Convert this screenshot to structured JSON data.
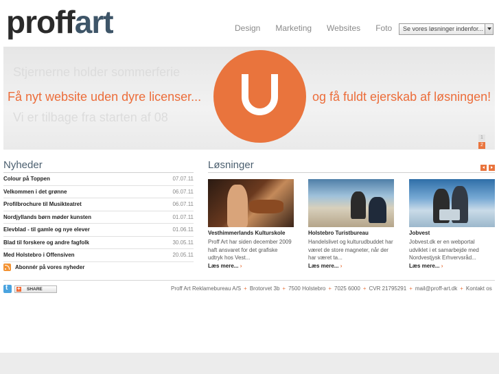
{
  "header": {
    "logo_part1": "proff",
    "logo_part2": "art",
    "nav": [
      "Design",
      "Marketing",
      "Websites",
      "Foto"
    ],
    "search_select_value": "Se vores løsninger indenfor..."
  },
  "banner": {
    "ghost_text_1": "Stjernerne holder sommerferie",
    "ghost_text_2": "Vi er tilbage fra starten af 08",
    "left_text": "Få nyt website uden dyre licenser...",
    "right_text": "og få fuldt ejerskab af løsningen!",
    "slides": [
      "1",
      "2"
    ],
    "accent_color": "#e9743d"
  },
  "news": {
    "title": "Nyheder",
    "items": [
      {
        "headline": "Colour på Toppen",
        "date": "07.07.11"
      },
      {
        "headline": "Velkommen i det grønne",
        "date": "06.07.11"
      },
      {
        "headline": "Profilbrochure til Musikteatret",
        "date": "06.07.11"
      },
      {
        "headline": "Nordjyllands børn møder kunsten",
        "date": "01.07.11"
      },
      {
        "headline": "Elevblad - til gamle og nye elever",
        "date": "01.06.11"
      },
      {
        "headline": "Blad til forskere og andre fagfolk",
        "date": "30.05.11"
      },
      {
        "headline": "Med Holstebro i Offensiven",
        "date": "20.05.11"
      }
    ],
    "subscribe_label": "Abonnér på vores nyheder"
  },
  "solutions": {
    "title": "Løsninger",
    "cards": [
      {
        "name": "Vesthimmerlands Kulturskole",
        "desc": [
          "Proff Art har siden december 2009",
          "haft ansvaret for det grafiske",
          "udtryk hos Vest..."
        ],
        "more": "Læs mere..."
      },
      {
        "name": "Holstebro Turistbureau",
        "desc": [
          "Handelslivet og kulturudbuddet har",
          "været de store magneter, når der",
          "har været ta..."
        ],
        "more": "Læs mere..."
      },
      {
        "name": "Jobvest",
        "desc": [
          "Jobvest.dk er en webportal",
          "udviklet i et samarbejde med",
          "Nordvestjysk Erhvervsråd..."
        ],
        "more": "Læs mere..."
      }
    ]
  },
  "footer": {
    "share_label": "SHARE",
    "info": [
      "Proff Art Reklamebureau A/S",
      "Brotorvet 3b",
      "7500 Holstebro",
      "7025 6000",
      "CVR 21795291",
      "mail@proff-art.dk",
      "Kontakt os"
    ]
  }
}
